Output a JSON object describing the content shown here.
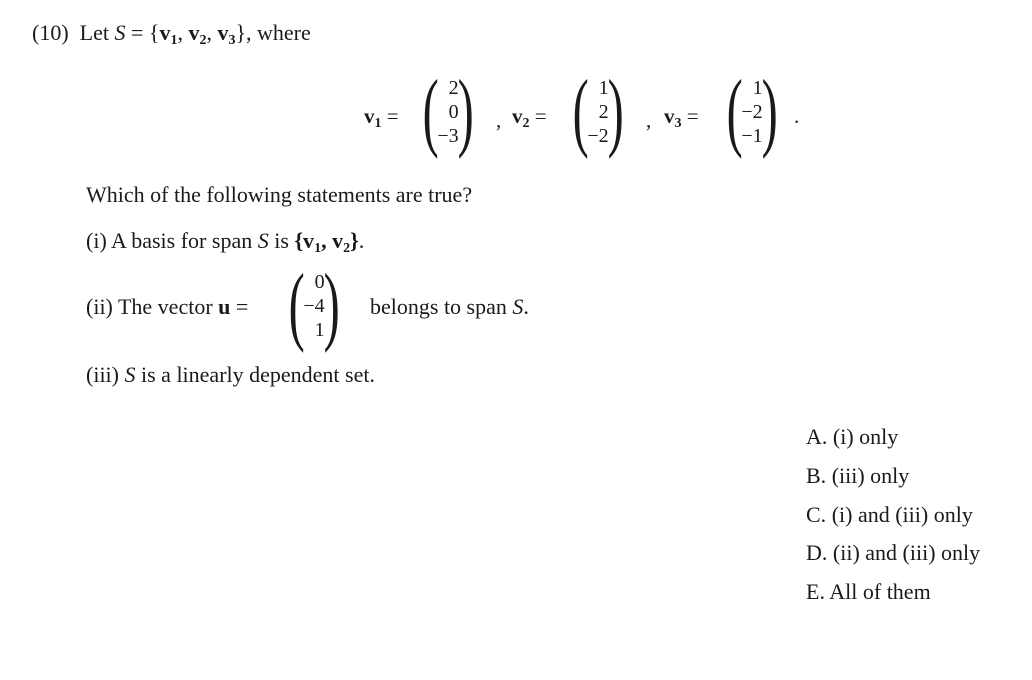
{
  "problem": {
    "number": "(10)",
    "intro_let": "Let",
    "set_name": "S",
    "equals": "=",
    "set_open": "{",
    "set_close": "},",
    "where": "where",
    "vectors": [
      {
        "name": "v",
        "sub": "1",
        "entries": [
          "2",
          "0",
          "−3"
        ],
        "sep": ","
      },
      {
        "name": "v",
        "sub": "2",
        "entries": [
          "1",
          "2",
          "−2"
        ],
        "sep": ","
      },
      {
        "name": "v",
        "sub": "3",
        "entries": [
          "1",
          "−2",
          "−1"
        ],
        "sep": "."
      }
    ],
    "question": "Which of the following statements are true?",
    "statements": {
      "i": {
        "prefix": "(i) A basis for span",
        "set": "S",
        "mid": "is",
        "basis": "{v₁, v₂}."
      },
      "ii": {
        "prefix": "(ii) The vector",
        "vec_name": "u",
        "eq": "=",
        "entries": [
          "0",
          "−4",
          "1"
        ],
        "suffix": "belongs to span",
        "set": "S",
        "end": "."
      },
      "iii": {
        "prefix": "(iii)",
        "set": "S",
        "text": "is a linearly dependent set."
      }
    },
    "options": [
      {
        "letter": "A.",
        "text": "(i) only"
      },
      {
        "letter": "B.",
        "text": "(iii) only"
      },
      {
        "letter": "C.",
        "text": "(i) and (iii) only"
      },
      {
        "letter": "D.",
        "text": "(ii) and (iii) only"
      },
      {
        "letter": "E.",
        "text": "All of them"
      }
    ]
  }
}
